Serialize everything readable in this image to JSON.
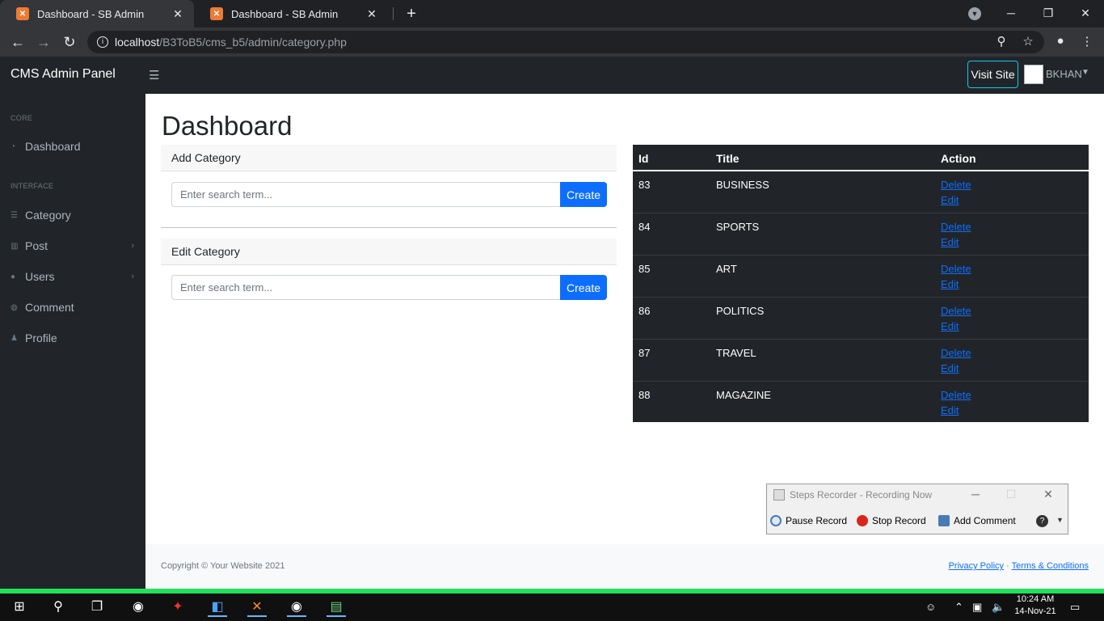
{
  "browser": {
    "tabs": [
      {
        "title": "Dashboard - SB Admin",
        "active": true
      },
      {
        "title": "Dashboard - SB Admin",
        "active": false
      }
    ],
    "url_host": "localhost",
    "url_path": "/B3ToB5/cms_b5/admin/category.php"
  },
  "navbar": {
    "brand": "CMS Admin Panel",
    "visit_site": "Visit Site",
    "user": "BKHAN"
  },
  "sidebar": {
    "core_heading": "CORE",
    "interface_heading": "INTERFACE",
    "items": [
      {
        "label": "Dashboard",
        "icon": "gauge-icon"
      },
      {
        "label": "Category",
        "icon": "list-icon"
      },
      {
        "label": "Post",
        "icon": "columns-icon"
      },
      {
        "label": "Users",
        "icon": "users-icon"
      },
      {
        "label": "Comment",
        "icon": "comment-icon"
      },
      {
        "label": "Profile",
        "icon": "user-icon"
      }
    ]
  },
  "main": {
    "title": "Dashboard",
    "add_category": {
      "header": "Add Category",
      "placeholder": "Enter search term...",
      "button": "Create"
    },
    "edit_category": {
      "header": "Edit Category",
      "placeholder": "Enter search term...",
      "button": "Create"
    },
    "table": {
      "columns": [
        "Id",
        "Title",
        "Action"
      ],
      "rows": [
        {
          "id": "83",
          "title": "BUSINESS",
          "delete": "Delete",
          "edit": "Edit"
        },
        {
          "id": "84",
          "title": "SPORTS",
          "delete": "Delete",
          "edit": "Edit"
        },
        {
          "id": "85",
          "title": "ART",
          "delete": "Delete",
          "edit": "Edit"
        },
        {
          "id": "86",
          "title": "POLITICS",
          "delete": "Delete",
          "edit": "Edit"
        },
        {
          "id": "87",
          "title": "TRAVEL",
          "delete": "Delete",
          "edit": "Edit"
        },
        {
          "id": "88",
          "title": "MAGAZINE",
          "delete": "Delete",
          "edit": "Edit"
        }
      ]
    }
  },
  "footer": {
    "copyright": "Copyright © Your Website 2021",
    "privacy": "Privacy Policy",
    "separator": "·",
    "terms": "Terms & Conditions"
  },
  "recorder": {
    "title": "Steps Recorder - Recording Now",
    "pause": "Pause Record",
    "stop": "Stop Record",
    "comment": "Add Comment",
    "help": "?"
  },
  "taskbar": {
    "time": "10:24 AM",
    "date": "14-Nov-21"
  },
  "colors": {
    "accent": "#0d6efd",
    "dark": "#212529",
    "taskbar_strip": "#22e05a"
  }
}
